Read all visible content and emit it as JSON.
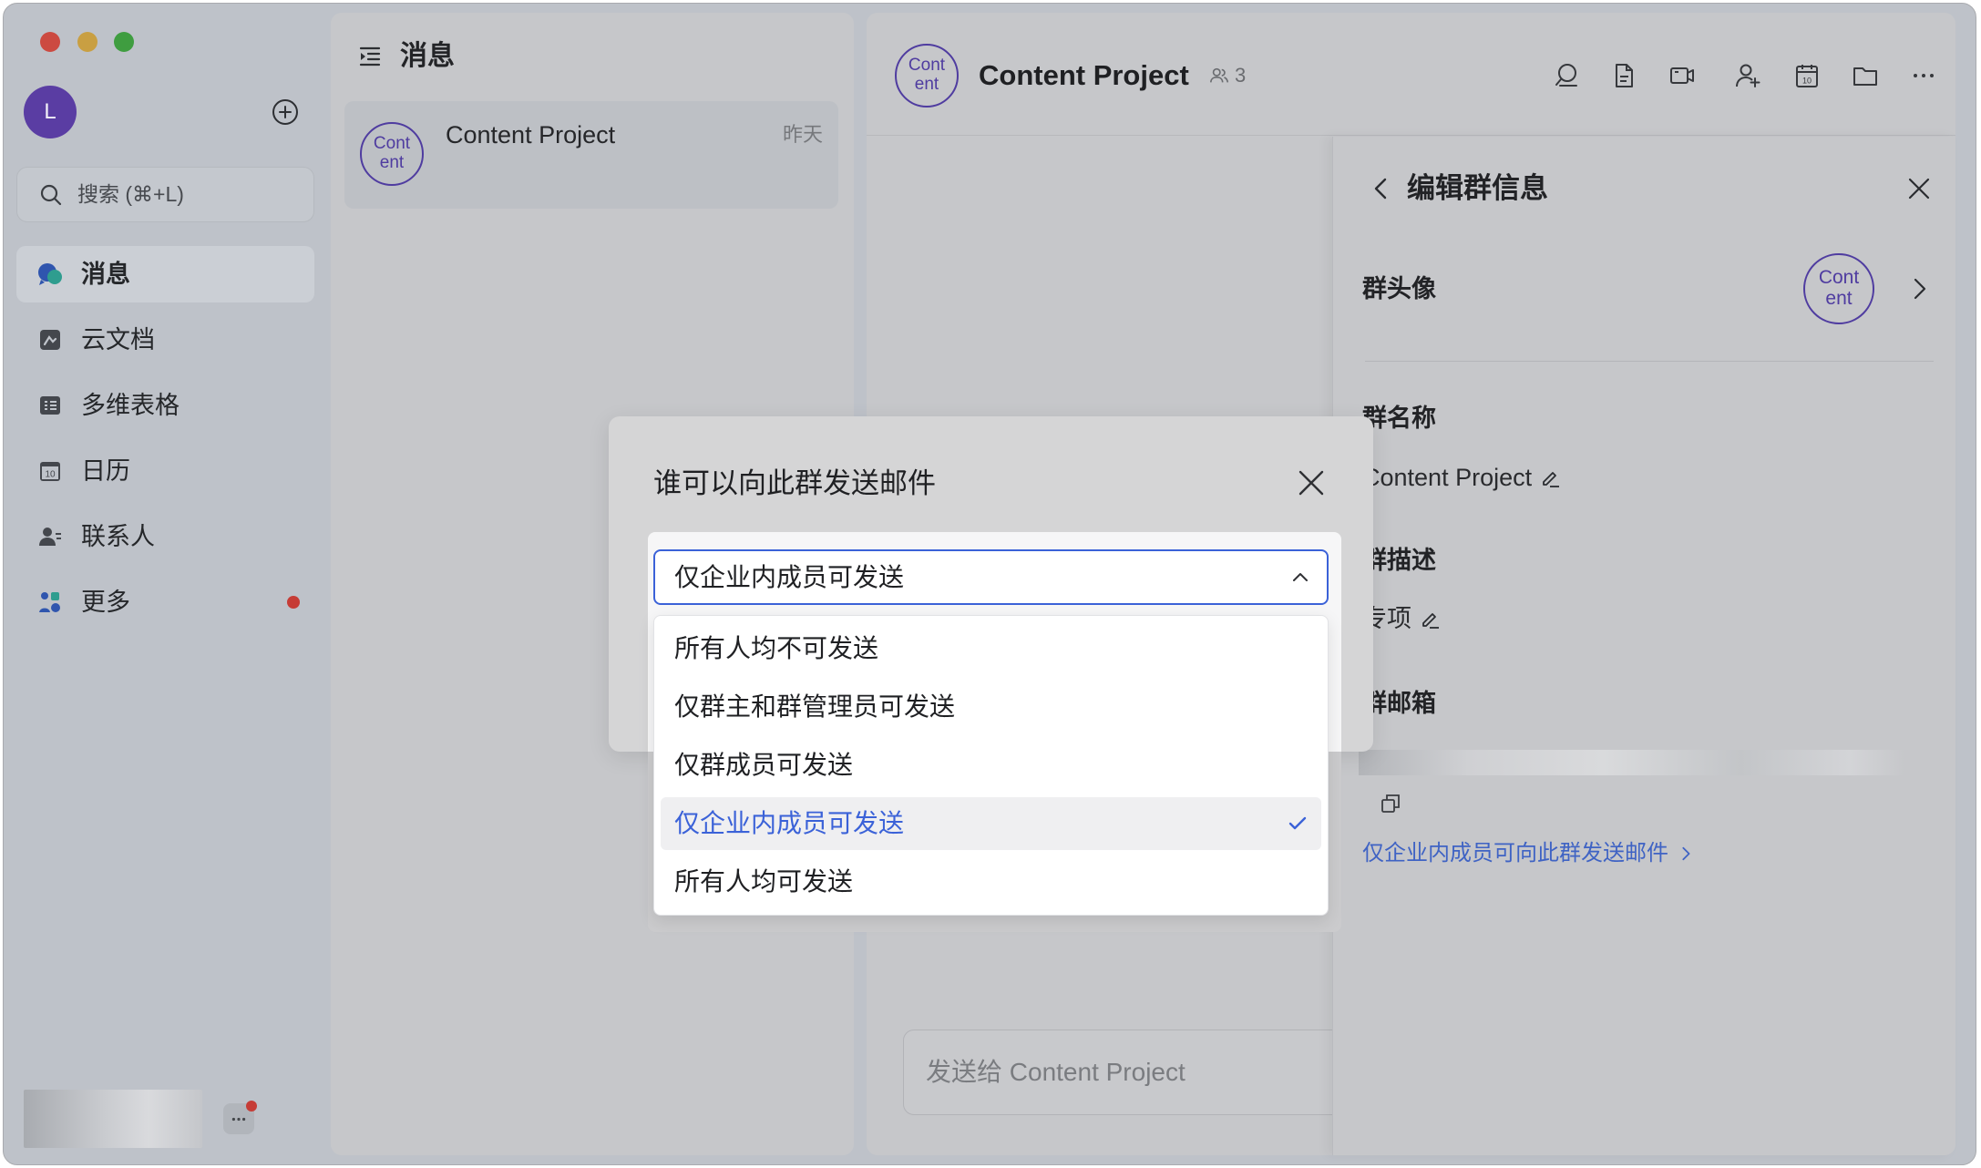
{
  "window": {
    "traffic_lights": [
      "close",
      "minimize",
      "zoom"
    ]
  },
  "sidebar": {
    "avatar_initial": "L",
    "search_placeholder": "搜索 (⌘+L)",
    "calendar_day": "10",
    "items": [
      {
        "label": "消息",
        "icon": "messages-icon",
        "active": true
      },
      {
        "label": "云文档",
        "icon": "docs-icon",
        "active": false
      },
      {
        "label": "多维表格",
        "icon": "base-table-icon",
        "active": false
      },
      {
        "label": "日历",
        "icon": "calendar-icon",
        "active": false
      },
      {
        "label": "联系人",
        "icon": "contacts-icon",
        "active": false
      },
      {
        "label": "更多",
        "icon": "more-apps-icon",
        "active": false,
        "has_badge": true
      }
    ],
    "bottom_icon": "chat-bubble-icon"
  },
  "message_list": {
    "title": "消息",
    "items": [
      {
        "avatar_line1": "Cont",
        "avatar_line2": "ent",
        "title": "Content Project",
        "time": "昨天",
        "selected": true
      }
    ]
  },
  "chat": {
    "avatar_line1": "Cont",
    "avatar_line2": "ent",
    "title": "Content Project",
    "member_count": "3",
    "calendar_day": "10",
    "toolbar_icons": [
      "search-icon",
      "document-icon",
      "video-call-icon",
      "add-member-icon",
      "calendar-icon",
      "folder-icon",
      "more-icon"
    ],
    "input_placeholder": "发送给 Content Project"
  },
  "group_info_panel": {
    "title": "编辑群信息",
    "avatar_label": "群头像",
    "avatar_line1": "Cont",
    "avatar_line2": "ent",
    "name_label": "群名称",
    "name_value": "Content Project",
    "description_label": "群描述",
    "description_value": "专项",
    "mailbox_label": "群邮箱",
    "mail_permission_link": "仅企业内成员可向此群发送邮件"
  },
  "dialog": {
    "title": "谁可以向此群发送邮件",
    "selected_value": "仅企业内成员可发送",
    "dropdown_open": true,
    "options": [
      "所有人均不可发送",
      "仅群主和群管理员可发送",
      "仅群成员可发送",
      "仅企业内成员可发送",
      "所有人均可发送"
    ],
    "selected_index": 3
  },
  "colors": {
    "accent_blue": "#3b62d8",
    "group_avatar_purple": "#4f3ca0",
    "user_avatar_bg": "#5a3da3",
    "badge_red": "#c63c36",
    "link_blue": "#3f63c4"
  }
}
